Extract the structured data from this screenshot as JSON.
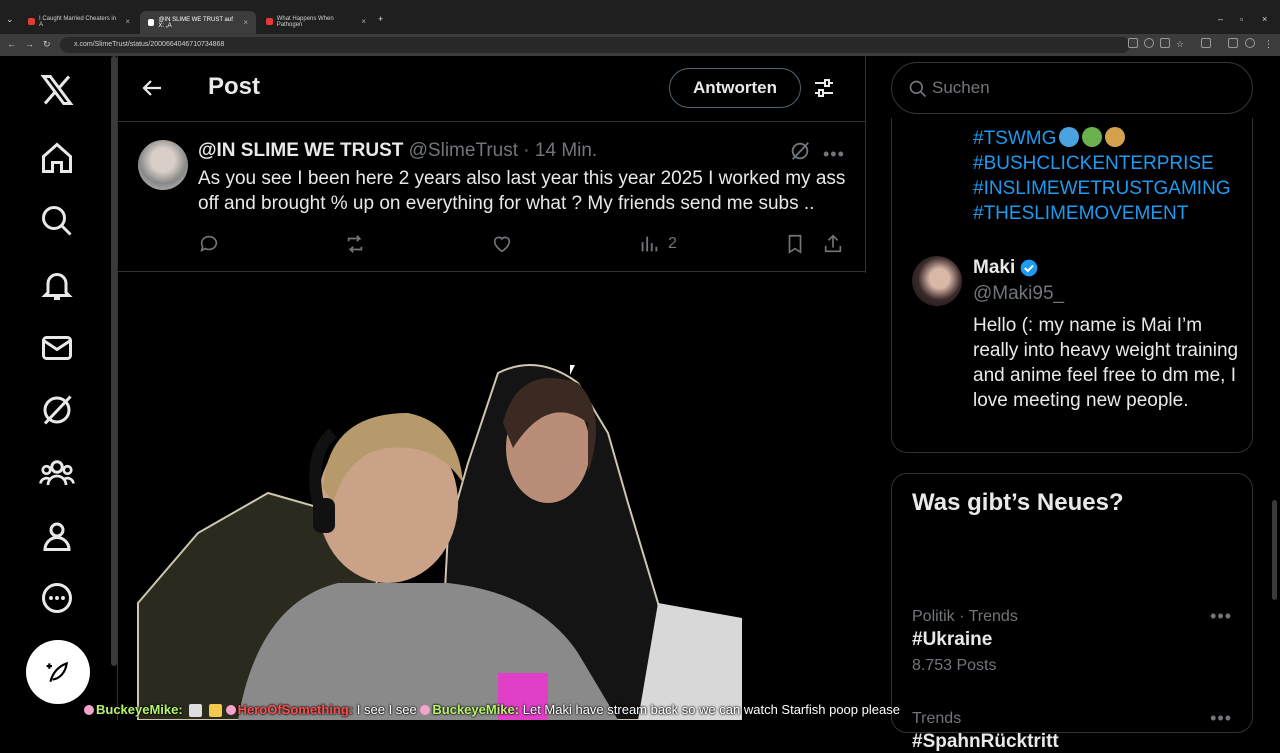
{
  "browser": {
    "tabs": [
      {
        "title": "I Caught Married Cheaters in A"
      },
      {
        "title": "@IN SLIME WE TRUST auf X: „A"
      },
      {
        "title": "What Happens When Pathogen"
      }
    ],
    "url": "x.com/SlimeTrust/status/2000664046710734868"
  },
  "header": {
    "title": "Post",
    "reply_label": "Antworten"
  },
  "tweet": {
    "name": "@IN SLIME WE TRUST",
    "handle": "@SlimeTrust",
    "separator": " · ",
    "time": "14 Min.",
    "text": "As you see I been here 2 years also last year  this year 2025 I worked my ass off and brought % up on everything for what ? My friends send me subs ..",
    "views": "2"
  },
  "search": {
    "placeholder": "Suchen"
  },
  "profile_card": {
    "hashtags": [
      "#TSWMG",
      "#BUSHCLICKENTERPRISE",
      "#INSLIMEWETRUSTGAMING",
      "#THESLIMEMOVEMENT"
    ],
    "name": "Maki",
    "handle": "@Maki95_",
    "bio": "Hello (: my name is Mai I’m really into heavy weight training and anime feel free to dm me, I love meeting new people."
  },
  "news": {
    "title": "Was gibt’s Neues?",
    "trends": [
      {
        "meta": "Politik · Trends",
        "name": "#Ukraine",
        "count": "8.753 Posts"
      },
      {
        "meta": "Trends",
        "name": "#SpahnRücktritt",
        "count": ""
      }
    ]
  },
  "chat": {
    "user1": "BuckeyeMike:",
    "user2": "HeroOfSomething:",
    "msg2": "I see I see",
    "user3": "BuckeyeMike:",
    "msg3": "Let Maki have stream back so we can watch Starfish poop please"
  },
  "colors": {
    "accent": "#1d9bf0",
    "muted": "#71767b",
    "border": "#2f3336"
  }
}
